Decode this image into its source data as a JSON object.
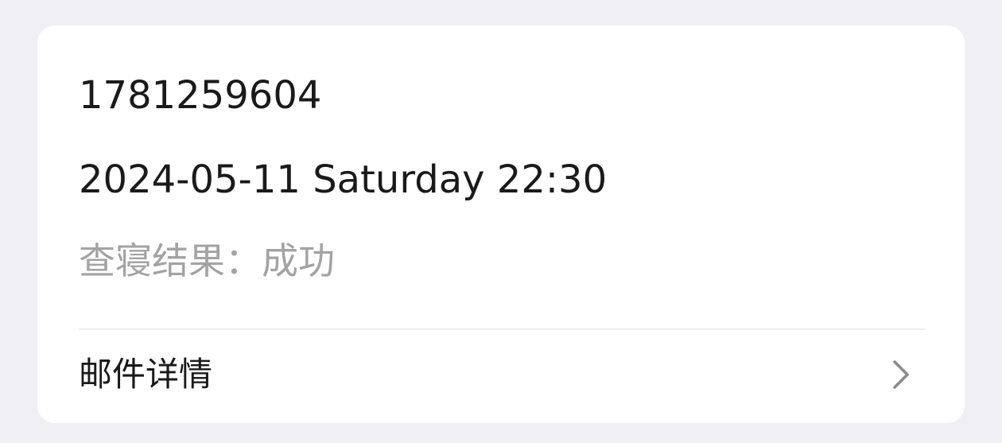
{
  "record": {
    "id": "1781259604",
    "datetime": "2024-05-11 Saturday 22:30",
    "result_label": "查寝结果：",
    "result_value": "成功"
  },
  "detail": {
    "label": "邮件详情",
    "icon": "chevron-right-icon"
  },
  "colors": {
    "page_background": "#efeff4",
    "card_background": "#ffffff",
    "primary_text": "#1a1a1a",
    "secondary_text": "#a3a3a3",
    "divider": "#ededed",
    "chevron": "#8a8a8a"
  }
}
